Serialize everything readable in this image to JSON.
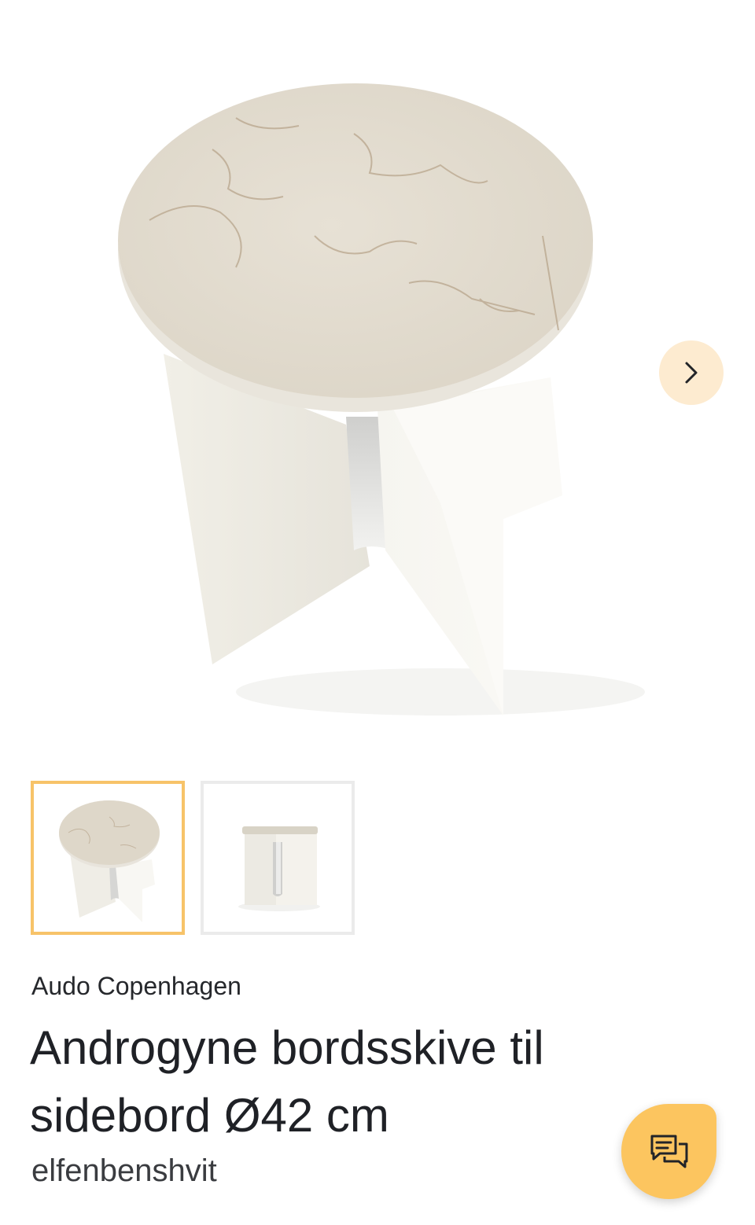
{
  "product": {
    "brand": "Audo Copenhagen",
    "title": "Androgyne bordsskive til sidebord Ø42 cm",
    "variant": "elfenbenshvit"
  },
  "gallery": {
    "image_count": 2,
    "selected_index": 0
  },
  "icons": {
    "next": "chevron-right-icon",
    "chat": "chat-bubbles-icon"
  },
  "colors": {
    "accent": "#f7c369",
    "chat_button": "#fcc55f",
    "next_button_bg": "#fdebd0",
    "thumb_border": "#ebebeb",
    "text": "#1f2126"
  }
}
